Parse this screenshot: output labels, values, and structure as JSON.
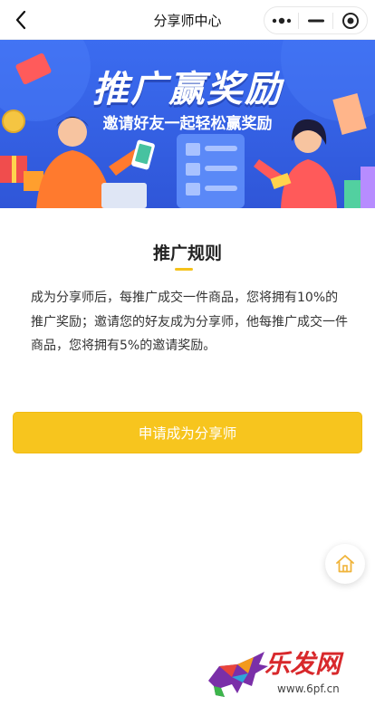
{
  "header": {
    "title": "分享师中心"
  },
  "banner": {
    "title": "推广赢奖励",
    "subtitle": "邀请好友一起轻松赢奖励"
  },
  "rules": {
    "title": "推广规则",
    "body": "成为分享师后，每推广成交一件商品，您将拥有10%的推广奖励；邀请您的好友成为分享师，他每推广成交一件商品，您将拥有5%的邀请奖励。"
  },
  "apply_button": {
    "label": "申请成为分享师"
  },
  "watermark": {
    "text": "乐发网",
    "url": "www.6pf.cn"
  },
  "colors": {
    "accent": "#f7c51e",
    "banner": "#3b6cf0"
  }
}
